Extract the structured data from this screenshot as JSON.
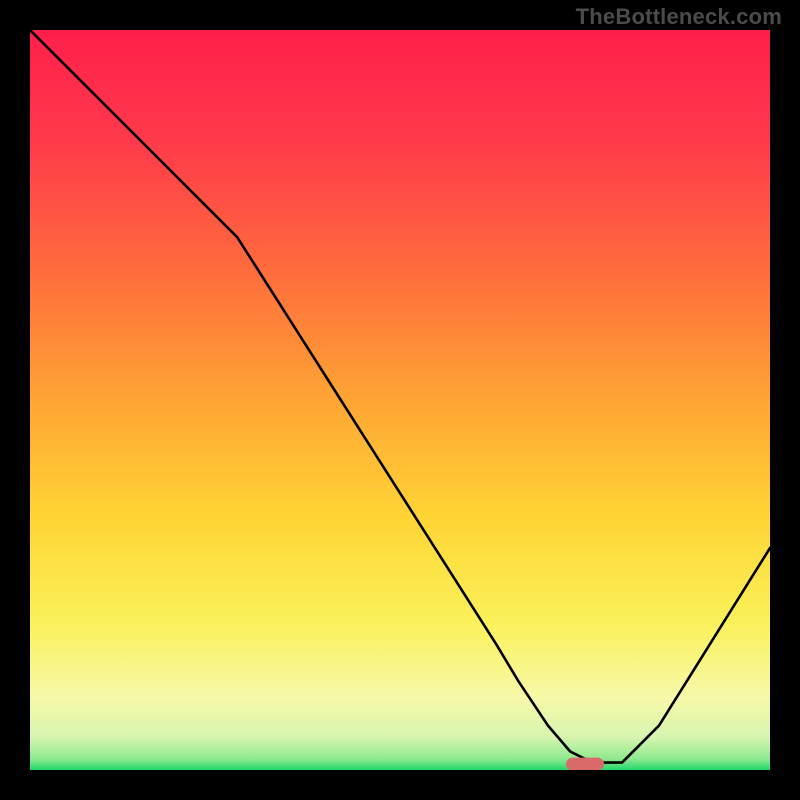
{
  "watermark": "TheBottleneck.com",
  "chart_data": {
    "type": "line",
    "title": "",
    "xlabel": "",
    "ylabel": "",
    "xlim": [
      0,
      100
    ],
    "ylim": [
      0,
      100
    ],
    "x": [
      0,
      7,
      14,
      21,
      28,
      35,
      42,
      49,
      56,
      63,
      66,
      70,
      73,
      76,
      80,
      85,
      90,
      95,
      100
    ],
    "curve": [
      100,
      93,
      86,
      79,
      72,
      61,
      50,
      39,
      28,
      17,
      12,
      6,
      2.5,
      1,
      1,
      6,
      14,
      22,
      30
    ],
    "marker": {
      "x": 75,
      "y": 0.8,
      "color": "#d86a6a"
    },
    "gradient_stops": [
      {
        "pos": 0.0,
        "color": "#ff1f4a"
      },
      {
        "pos": 0.15,
        "color": "#ff3a4a"
      },
      {
        "pos": 0.32,
        "color": "#ff6a3d"
      },
      {
        "pos": 0.5,
        "color": "#ffa534"
      },
      {
        "pos": 0.66,
        "color": "#ffd534"
      },
      {
        "pos": 0.8,
        "color": "#faf15a"
      },
      {
        "pos": 0.9,
        "color": "#f7f9a7"
      },
      {
        "pos": 0.955,
        "color": "#d9f5b0"
      },
      {
        "pos": 0.985,
        "color": "#8fe98f"
      },
      {
        "pos": 1.0,
        "color": "#1fd86b"
      }
    ]
  }
}
